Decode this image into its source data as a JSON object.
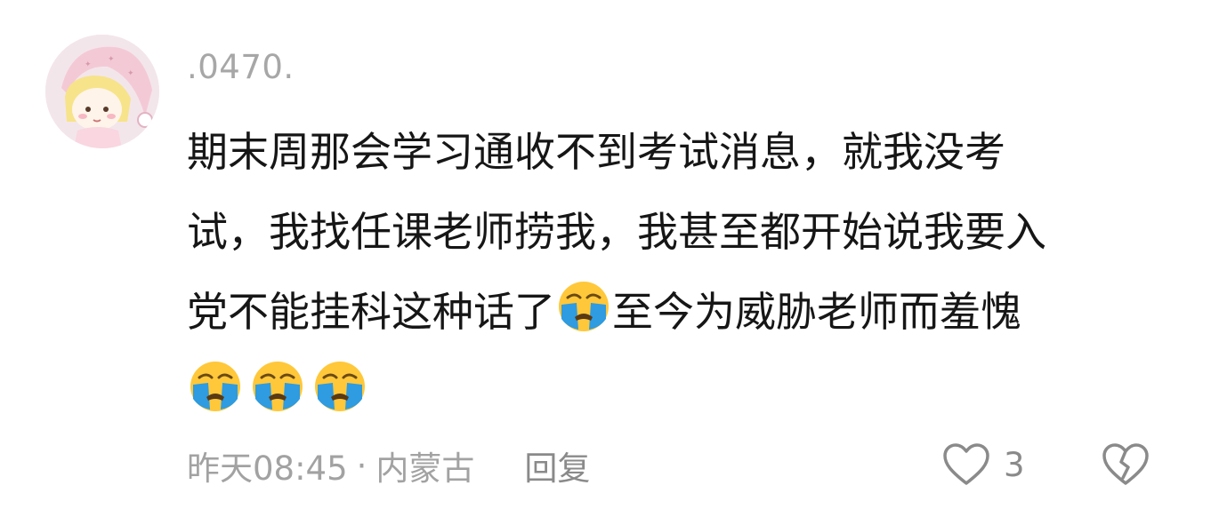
{
  "comment": {
    "username": ".0470.",
    "text_line1": "期末周那会学习通收不到考试消息，就我没考",
    "text_line2": "试，我找任课老师捞我，我甚至都开始说我要入",
    "text_line3_a": "党不能挂科这种话了",
    "text_line3_b": "至今为威胁老师而羞愧",
    "emoji_name": "loudly-crying-face",
    "time": "昨天08:45",
    "separator": "·",
    "location": "内蒙古",
    "reply_label": "回复",
    "like_count": "3"
  },
  "colors": {
    "username": "#a7a7a7",
    "text": "#161616",
    "meta": "#a2a2a2",
    "icon": "#8a8a8a",
    "emoji_face": "#ffc83a",
    "emoji_tears": "#2f9be0"
  }
}
